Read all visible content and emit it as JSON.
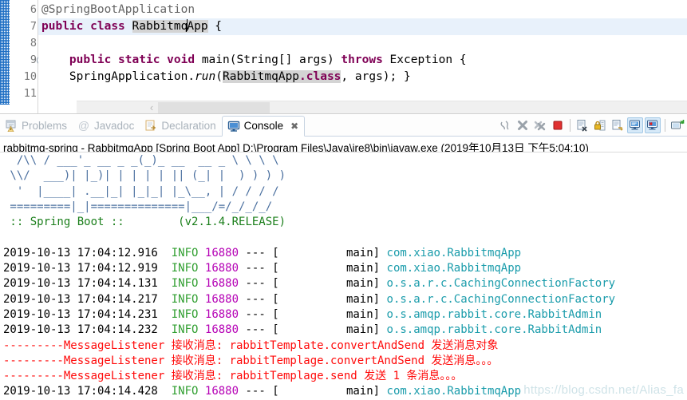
{
  "editor": {
    "lines": [
      {
        "num": "6",
        "fold": false,
        "highlight": false,
        "text": "@SpringBootApplication"
      },
      {
        "num": "7",
        "fold": false,
        "highlight": true,
        "text": "public class RabbitmqApp {"
      },
      {
        "num": "8",
        "fold": false,
        "highlight": false,
        "text": ""
      },
      {
        "num": "9",
        "fold": true,
        "highlight": false,
        "text": "    public static void main(String[] args) throws Exception {"
      },
      {
        "num": "10",
        "fold": false,
        "highlight": false,
        "text": "    SpringApplication.run(RabbitmqApp.class, args); }"
      },
      {
        "num": "11",
        "fold": false,
        "highlight": false,
        "text": ""
      }
    ],
    "class_name": "RabbitmqApp",
    "scroll_left_arrow": "‹"
  },
  "view": {
    "tabs": [
      {
        "label": "Problems",
        "icon": "problems-icon",
        "active": false,
        "closable": false
      },
      {
        "label": "Javadoc",
        "icon": "javadoc-icon",
        "active": false,
        "closable": false
      },
      {
        "label": "Declaration",
        "icon": "declaration-icon",
        "active": false,
        "closable": false
      },
      {
        "label": "Console",
        "icon": "console-icon",
        "active": true,
        "closable": true,
        "close_glyph": "✖"
      }
    ],
    "toolbar": [
      {
        "name": "terminate-all-icon",
        "toggled": false
      },
      {
        "name": "remove-launch-icon",
        "toggled": false
      },
      {
        "name": "remove-all-launches-icon",
        "toggled": false
      },
      {
        "name": "terminate-icon",
        "toggled": false
      },
      {
        "name": "separator-1",
        "toggled": false
      },
      {
        "name": "clear-console-icon",
        "toggled": false
      },
      {
        "name": "scroll-lock-icon",
        "toggled": false
      },
      {
        "name": "word-wrap-icon",
        "toggled": false
      },
      {
        "name": "show-console-on-output-icon",
        "toggled": true
      },
      {
        "name": "show-console-on-error-icon",
        "toggled": true
      },
      {
        "name": "separator-2",
        "toggled": false
      },
      {
        "name": "open-console-icon",
        "toggled": false
      }
    ]
  },
  "console": {
    "header": "rabbitmq-spring - RabbitmqApp [Spring Boot App] D:\\Program Files\\Java\\jre8\\bin\\javaw.exe (2019年10月13日 下午5:04:10)",
    "banner": [
      "  /\\\\ / ___'_ __ _ _(_)_ __  __ _ \\ \\ \\ \\",
      " \\\\/  ___)| |_)| | | | | || (_| |  ) ) ) )",
      "  '  |____| .__|_| |_|_| |_\\__, | / / / /",
      " =========|_|==============|___/=/_/_/_/"
    ],
    "banner_footer_left": " :: Spring Boot :: ",
    "banner_footer_right": "       (v2.1.4.RELEASE)",
    "log_lines": [
      {
        "type": "log",
        "timestamp": "2019-10-13 17:04:12.916",
        "level": "INFO",
        "pid": "16880",
        "sep": "---",
        "thread": "main",
        "logger": "com.xiao.RabbitmqApp"
      },
      {
        "type": "log",
        "timestamp": "2019-10-13 17:04:12.919",
        "level": "INFO",
        "pid": "16880",
        "sep": "---",
        "thread": "main",
        "logger": "com.xiao.RabbitmqApp"
      },
      {
        "type": "log",
        "timestamp": "2019-10-13 17:04:14.131",
        "level": "INFO",
        "pid": "16880",
        "sep": "---",
        "thread": "main",
        "logger": "o.s.a.r.c.CachingConnectionFactory"
      },
      {
        "type": "log",
        "timestamp": "2019-10-13 17:04:14.217",
        "level": "INFO",
        "pid": "16880",
        "sep": "---",
        "thread": "main",
        "logger": "o.s.a.r.c.CachingConnectionFactory"
      },
      {
        "type": "log",
        "timestamp": "2019-10-13 17:04:14.231",
        "level": "INFO",
        "pid": "16880",
        "sep": "---",
        "thread": "main",
        "logger": "o.s.amqp.rabbit.core.RabbitAdmin"
      },
      {
        "type": "log",
        "timestamp": "2019-10-13 17:04:14.232",
        "level": "INFO",
        "pid": "16880",
        "sep": "---",
        "thread": "main",
        "logger": "o.s.amqp.rabbit.core.RabbitAdmin"
      },
      {
        "type": "red",
        "text": "---------MessageListener 接收消息: rabbitTemplate.convertAndSend 发送消息对象"
      },
      {
        "type": "red",
        "text": "---------MessageListener 接收消息: rabbitTemplage.convertAndSend 发送消息。。。"
      },
      {
        "type": "red",
        "text": "---------MessageListener 接收消息: rabbitTemplage.send 发送 1 条消息。。。"
      },
      {
        "type": "log",
        "timestamp": "2019-10-13 17:04:14.428",
        "level": "INFO",
        "pid": "16880",
        "sep": "---",
        "thread": "main",
        "logger": "com.xiao.RabbitmqApp"
      }
    ]
  },
  "watermark": "https://blog.csdn.net/Alias_fa",
  "colors": {
    "keyword": "#7f0055",
    "info_green": "#2f9e2f",
    "pid_magenta": "#b500b5",
    "logger_teal": "#1a9cab",
    "red": "#ff0a0a",
    "banner_green": "#1b7f1b",
    "highlight_row": "#e8f1fb"
  }
}
